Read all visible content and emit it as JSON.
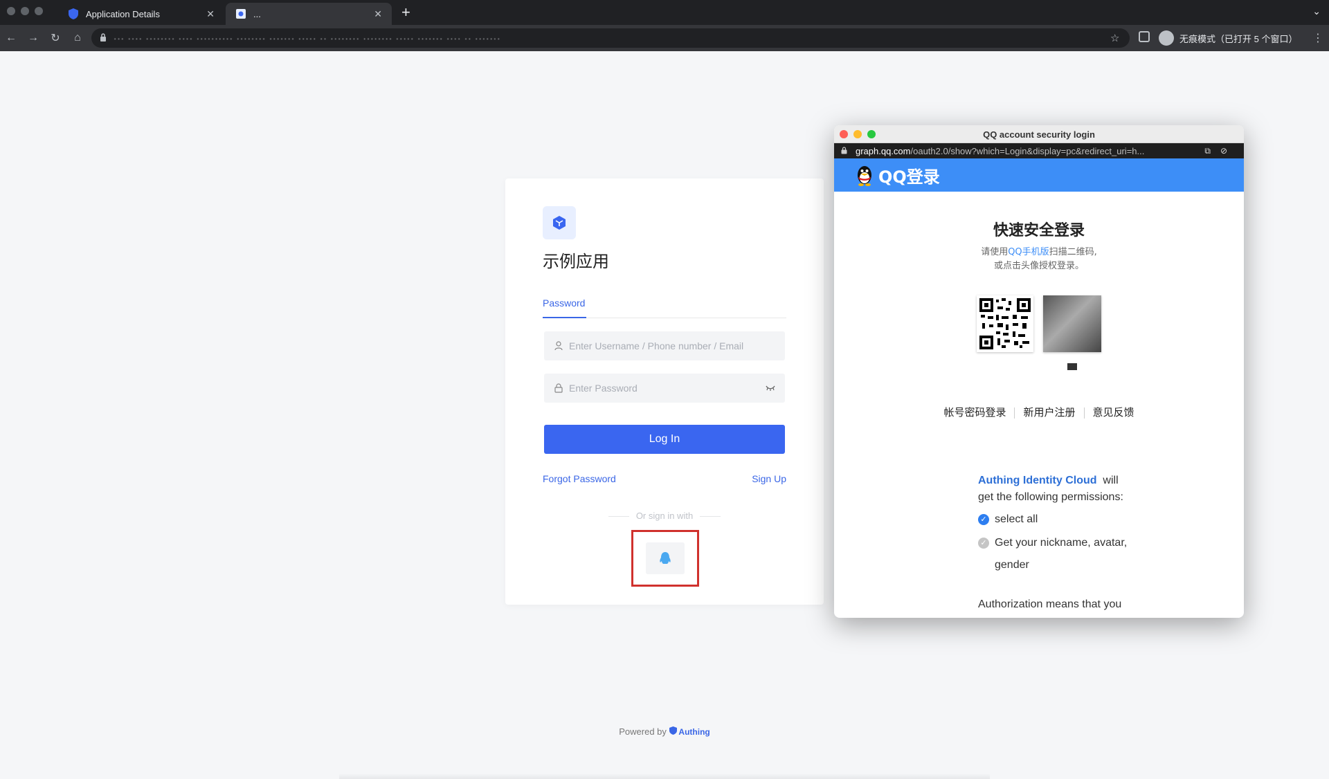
{
  "browser": {
    "tabs": [
      {
        "label": "Application Details",
        "active": false
      },
      {
        "label": "...",
        "active": true
      }
    ],
    "new_tab": "+",
    "url": "··· ···· ········ ···· ·········· ········ ······· ····· ·· ········ ········ ····· ······· ···· ·· ·······",
    "incognito_label": "无痕模式（已打开 5 个窗口）"
  },
  "login": {
    "app_name": "示例应用",
    "tab_password": "Password",
    "username_placeholder": "Enter Username / Phone number / Email",
    "password_placeholder": "Enter Password",
    "login_button": "Log In",
    "forgot_password": "Forgot Password",
    "sign_up": "Sign Up",
    "or_sign_in_with": "Or sign in with"
  },
  "footer": {
    "powered_by": "Powered by",
    "brand": "Authing"
  },
  "popup": {
    "window_title": "QQ account security login",
    "url_host": "graph.qq.com",
    "url_path": "/oauth2.0/show?which=Login&display=pc&redirect_uri=h...",
    "header": "QQ登录",
    "quick_login": "快速安全登录",
    "hint_prefix": "请使用",
    "hint_link": "QQ手机版",
    "hint_suffix": "扫描二维码,",
    "hint_line2": "或点击头像授权登录。",
    "link_account": "帐号密码登录",
    "link_register": "新用户注册",
    "link_feedback": "意见反馈",
    "app_name": "Authing Identity Cloud",
    "will": "will",
    "perm_intro": "get the following permissions:",
    "perm_select_all": "select all",
    "perm_nickname": "Get your nickname, avatar, gender",
    "authorization": "Authorization means that you"
  },
  "colors": {
    "accent": "#3a66f0",
    "qq_blue": "#3d8ef7",
    "highlight": "#d0312d"
  }
}
